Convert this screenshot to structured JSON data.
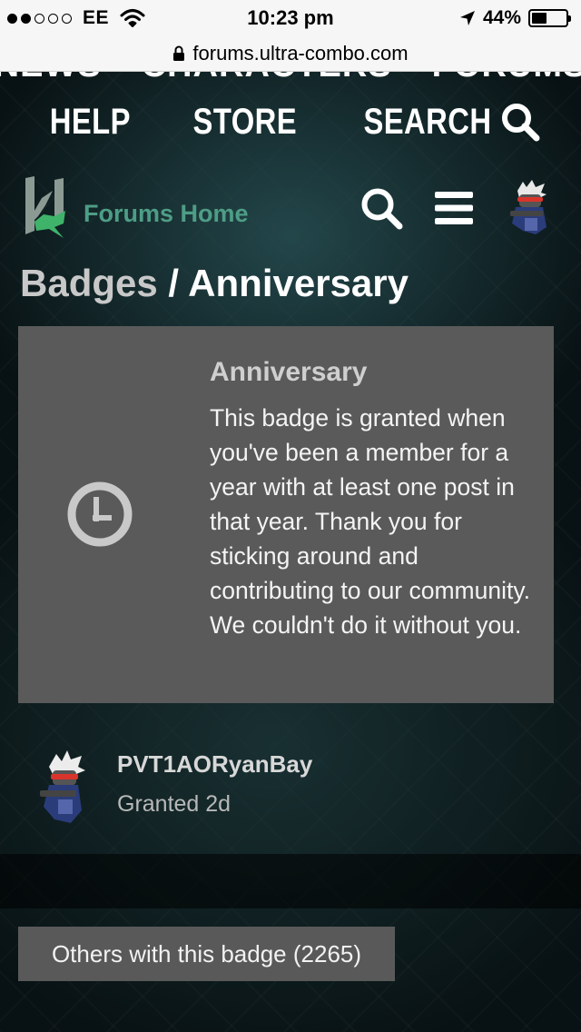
{
  "status_bar": {
    "carrier": "EE",
    "time": "10:23 pm",
    "battery": "44%",
    "battery_level": 0.44,
    "signal_bars": 2
  },
  "browser": {
    "url": "forums.ultra-combo.com"
  },
  "top_nav": {
    "cut_off_items": [
      "NEWS",
      "CHARACTERS",
      "FORUMS"
    ],
    "help": "HELP",
    "store": "STORE",
    "search": "SEARCH"
  },
  "forum_header": {
    "home_label": "Forums Home"
  },
  "page": {
    "crumb": "Badges",
    "separator": " / ",
    "title": "Anniversary"
  },
  "badge": {
    "icon": "clock-icon",
    "name": "Anniversary",
    "description": "This badge is granted when you've been a member for a year with at least one post in that year. Thank you for sticking around and contributing to our community. We couldn't do it without you."
  },
  "grant": {
    "username": "PVT1AORyanBay",
    "granted": "Granted 2d"
  },
  "others_button": "Others with this badge (2265)",
  "colors": {
    "card_bg": "#5a5a5a",
    "accent_green": "#4e9d86",
    "button_bg": "#595959"
  }
}
